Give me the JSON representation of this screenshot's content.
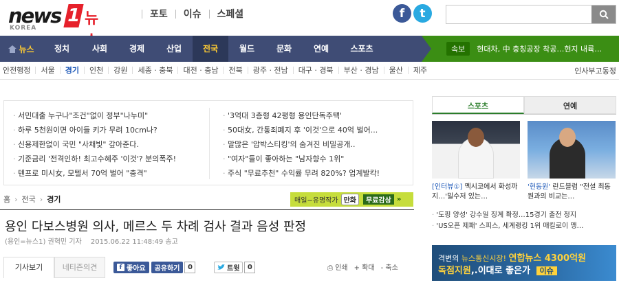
{
  "header": {
    "logo_main": "news",
    "logo_one": "1",
    "logo_suffix": "뉴스",
    "logo_sub": "KOREA",
    "top_menu": [
      "포토",
      "이슈",
      "스페셜"
    ],
    "search_placeholder": ""
  },
  "gnb": {
    "home_label": "뉴스",
    "items": [
      "정치",
      "사회",
      "경제",
      "산업",
      "전국",
      "월드",
      "문화",
      "연예",
      "스포츠"
    ],
    "active": "전국",
    "breaking_tag": "속보",
    "breaking_text": "현대차, 中 충칭공장 착공…현지 내륙…"
  },
  "regions": {
    "items": [
      "안전행정",
      "서울",
      "경기",
      "인천",
      "강원",
      "세종 · 충북",
      "대전 · 충남",
      "전북",
      "광주 · 전남",
      "대구 · 경북",
      "부산 · 경남",
      "울산",
      "제주"
    ],
    "active": "경기",
    "right": [
      "인사",
      "부고",
      "동정"
    ]
  },
  "ads": {
    "left": [
      "서민대출 누구나\"조건\"없이 정부\"나누미\"",
      "하루 5천원이면 아이들 키가 무려 10cm나?",
      "신용제한없이 국민 \"사채빛\" 갚아준다.",
      "기준금리 '전격인하! 최고수혜주 '이것'? 분의폭주!",
      "텐프로 미시女, 모텔서 70억 벌어 \"충격\""
    ],
    "right": [
      "'3억대 3층형 42평형 용인단독주택'",
      "50대女, 간통죄폐지 후 '이것'으로 40억 벌어...",
      "말많은 '압박스티킹'의 숨겨진 비밀공개..",
      "\"여자\"들이 좋아하는 \"남자향수 1위\"",
      "주식 \"무료추천\" 수익률 무려 820%? 업계발칵!"
    ]
  },
  "breadcrumb": [
    "홈",
    "전국",
    "경기"
  ],
  "promo_banner": {
    "a": "매일~유명작가",
    "b": "만화",
    "c": "무료감상",
    "d": "»"
  },
  "article": {
    "title": "용인 다보스병원 의사, 메르스 두 차례 검사 결과 음성 판정",
    "byline": "(용인=뉴스1) 권혁민 기자",
    "date": "2015.06.22 11:48:49 송고",
    "tabs": [
      "기사보기",
      "네티즌의견"
    ],
    "fb_label": "좋아요",
    "share_label": "공유하기",
    "share_count": "0",
    "tweet_label": "트윗",
    "tweet_count": "0",
    "tools": [
      "인쇄",
      "확대",
      "축소"
    ]
  },
  "sidebar": {
    "tabs": [
      "스포츠",
      "연예"
    ],
    "photo_captions": [
      {
        "tag": "[인터뷰①]",
        "text": "멕시코에서 화성까지…'밀수저 있는…"
      },
      {
        "tag": "'현동원'",
        "text": "린드블럼 \"전설 최동원과의 비교는…"
      }
    ],
    "list": [
      "'도핑 양성' 강수일 징계 확정…15경기 출전 정지",
      "'US오픈 제패' 스피스, 세계랭킹 1위 매킬로이 맹…"
    ],
    "banner": {
      "l1a": "격변의",
      "l1b": "뉴스통신시장!",
      "l1c": "연합뉴스 4300억원",
      "l2a": "독점지원",
      "l2b": ",.이대로 좋은가",
      "btn": "이슈"
    }
  }
}
